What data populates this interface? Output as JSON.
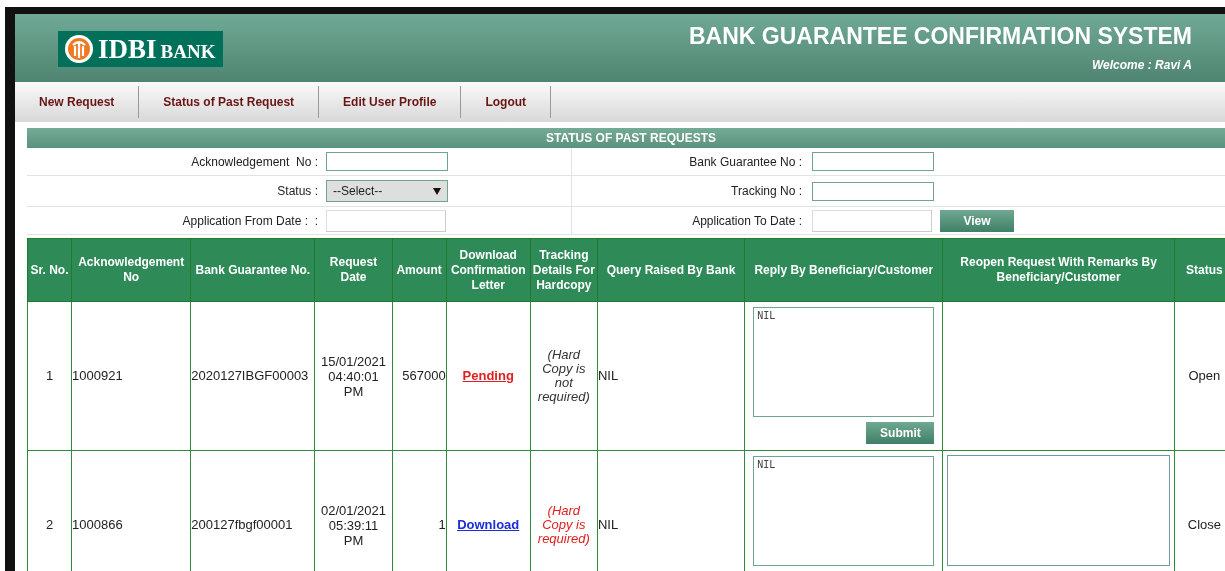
{
  "header": {
    "logo": {
      "brand": "IDBI",
      "suffix": "BANK"
    },
    "title": "BANK GUARANTEE CONFIRMATION SYSTEM",
    "welcome": "Welcome : Ravi A"
  },
  "nav": [
    "New Request",
    "Status of Past Request",
    "Edit User Profile",
    "Logout"
  ],
  "section_title": "STATUS OF PAST REQUESTS",
  "filters": [
    {
      "left": {
        "label": "Acknowledgement  No :",
        "kind": "text"
      },
      "right": {
        "label": "Bank Guarantee No :",
        "kind": "text"
      }
    },
    {
      "left": {
        "label": "Status :",
        "kind": "select",
        "value": "--Select--"
      },
      "right": {
        "label": "Tracking No :",
        "kind": "text"
      }
    },
    {
      "left": {
        "label": "Application From Date :  :",
        "kind": "date"
      },
      "right": {
        "label": "Application To Date :",
        "kind": "date"
      },
      "button": "View"
    }
  ],
  "table": {
    "columns": [
      "Sr. No.",
      "Acknowledgement No",
      "Bank Guarantee No.",
      "Request Date",
      "Amount",
      "Download Confirmation Letter",
      "Tracking Details For Hardcopy",
      "Query Raised By Bank",
      "Reply By Beneficiary/Customer",
      "Reopen Request With Remarks By Beneficiary/Customer",
      "Status"
    ],
    "rows": [
      {
        "sr": "1",
        "ack": "1000921",
        "bg": "2020127IBGF00003",
        "date": [
          "15/01/2021",
          "04:40:01",
          "PM"
        ],
        "amount": "567000",
        "letter": {
          "label": "Pending",
          "kind": "pending"
        },
        "tracking": {
          "text": "(Hard Copy is not required)",
          "required": false
        },
        "query": "NIL",
        "reply": "NIL",
        "submit": "Submit",
        "reopen_field": false,
        "status": "Open"
      },
      {
        "sr": "2",
        "ack": "1000866",
        "bg": "200127fbgf00001",
        "date": [
          "02/01/2021",
          "05:39:11",
          "PM"
        ],
        "amount": "1",
        "letter": {
          "label": "Download",
          "kind": "download"
        },
        "tracking": {
          "text": "(Hard Copy is required)",
          "required": true
        },
        "query": "NIL",
        "reply": "NIL",
        "reopen_field": true,
        "status": "Close"
      }
    ]
  }
}
